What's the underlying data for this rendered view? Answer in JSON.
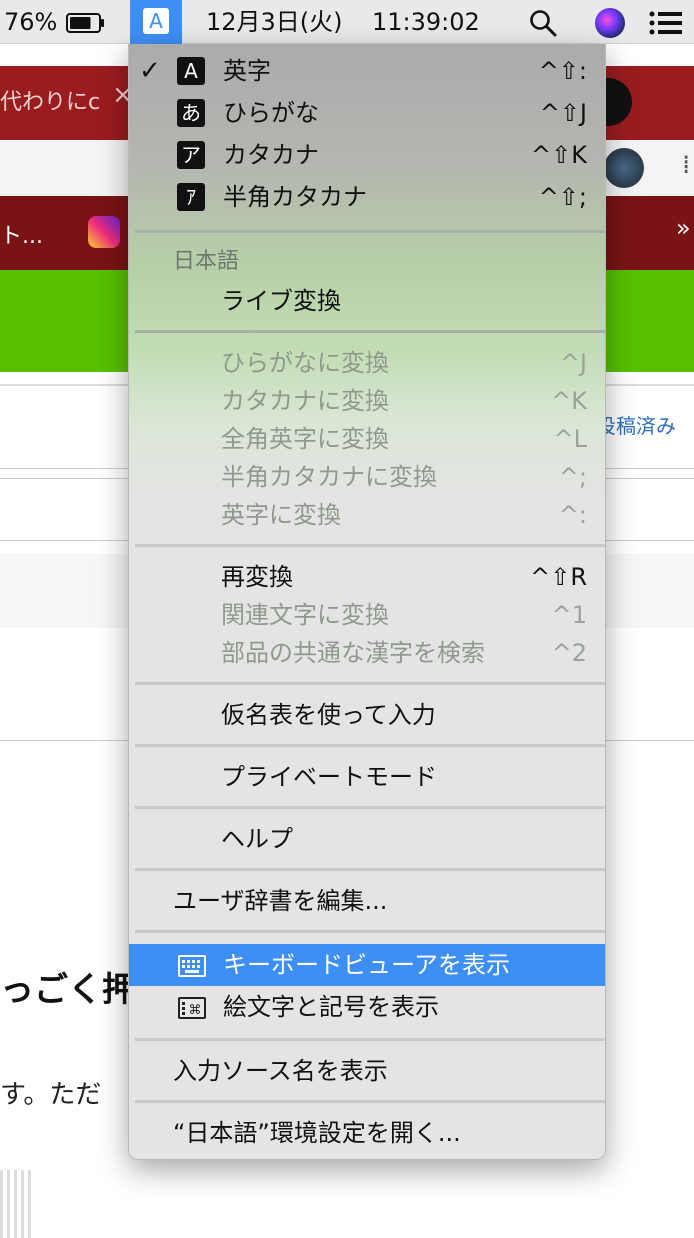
{
  "menubar": {
    "battery_percent": "76%",
    "battery_level": 0.76,
    "input_source_glyph": "A",
    "date": "12月3日(火)",
    "time": "11:39:02",
    "icons": [
      "battery-icon",
      "input-source-icon",
      "search-icon",
      "siri-icon",
      "control-center-icon"
    ]
  },
  "background": {
    "tab_text": "代わりにc",
    "tab_close": "×",
    "row_text": "ト...",
    "more_chevron": "»",
    "posted_badge": "投稿済み",
    "heading_text": "っごく押",
    "body_text": "す。ただ"
  },
  "menu": {
    "modes": [
      {
        "badge": "A",
        "label": "英字",
        "shortcut": "^⇧:",
        "checked": "✓"
      },
      {
        "badge": "あ",
        "label": "ひらがな",
        "shortcut": "^⇧J"
      },
      {
        "badge": "ア",
        "label": "カタカナ",
        "shortcut": "^⇧K"
      },
      {
        "badge": "ｱ",
        "label": "半角カタカナ",
        "shortcut": "^⇧;"
      }
    ],
    "section_heading": "日本語",
    "live_conversion": "ライブ変換",
    "convert_items": [
      {
        "label": "ひらがなに変換",
        "shortcut": "^J"
      },
      {
        "label": "カタカナに変換",
        "shortcut": "^K"
      },
      {
        "label": "全角英字に変換",
        "shortcut": "^L"
      },
      {
        "label": "半角カタカナに変換",
        "shortcut": "^;"
      },
      {
        "label": "英字に変換",
        "shortcut": "^:"
      }
    ],
    "reconvert": {
      "label": "再変換",
      "shortcut": "^⇧R"
    },
    "related_chars": {
      "label": "関連文字に変換",
      "shortcut": "^1"
    },
    "search_kanji": {
      "label": "部品の共通な漢字を検索",
      "shortcut": "^2"
    },
    "kana_table": "仮名表を使って入力",
    "private_mode": "プライベートモード",
    "help": "ヘルプ",
    "edit_dictionary": "ユーザ辞書を編集...",
    "show_keyboard_viewer": "キーボードビューアを表示",
    "show_emoji": "絵文字と記号を表示",
    "show_input_source_name": "入力ソース名を表示",
    "open_preferences": "“日本語”環境設定を開く..."
  },
  "colors": {
    "highlight": "#3d8ff5",
    "green_banner": "#56c000",
    "tab_red": "#9b1c1f"
  }
}
